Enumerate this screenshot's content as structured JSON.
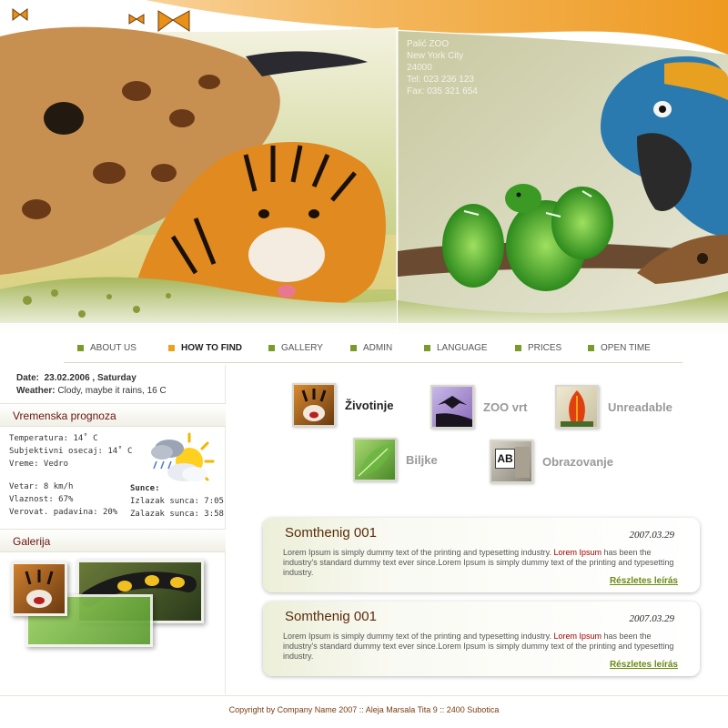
{
  "header": {
    "contact": {
      "name": "Palić ZOO",
      "city": "New York City",
      "zip": "24000",
      "tel": "Tel: 023 236 123",
      "fax": "Fax: 035 321 654"
    },
    "colors": {
      "orange": "#f0a030",
      "green": "#a8b850",
      "cream": "#f4e8c4"
    }
  },
  "nav": {
    "items": [
      {
        "label": "ABOUT US"
      },
      {
        "label": "HOW TO FIND",
        "active": true
      },
      {
        "label": "GALLERY"
      },
      {
        "label": "ADMIN"
      },
      {
        "label": "LANGUAGE"
      },
      {
        "label": "PRICES"
      },
      {
        "label": "OPEN TIME"
      }
    ]
  },
  "sidebar": {
    "date_label": "Date:",
    "date_value": "23.02.2006 ,  Saturday",
    "weather_label": "Weather:",
    "weather_value": "Clody, maybe it rains, 16 C",
    "forecast_heading": "Vremenska prognoza",
    "forecast": {
      "temperature": "Temperatura: 14˚ C",
      "subjective": "Subjektivni osecaj: 14˚ C",
      "conditions": "Vreme: Vedro",
      "wind": "Vetar: 8 km/h",
      "humidity": "Vlaznost: 67%",
      "precipitation": "Verovat. padavina: 20%",
      "sun_heading": "Sunce:",
      "sunrise": "Izlazak sunca: 7:05",
      "sunset": "Zalazak sunca: 3:58"
    },
    "gallery_heading": "Galerija"
  },
  "categories": [
    {
      "label": "Životinje",
      "dark": true
    },
    {
      "label": "ZOO vrt"
    },
    {
      "label": "Unreadable"
    },
    {
      "label": "Biljke"
    },
    {
      "label": "Obrazovanje"
    }
  ],
  "book_icon_text": "AB",
  "news": [
    {
      "title": "Somthenig 001",
      "date": "2007.03.29",
      "text_before": "Lorem Ipsum is simply dummy text of the printing and typesetting industry. ",
      "highlight": "Lorem Ipsum",
      "text_after": " has been the industry's standard dummy text ever since.Lorem Ipsum is simply dummy text of the printing and typesetting industry.",
      "more": "Részletes leírás"
    },
    {
      "title": "Somthenig 001",
      "date": "2007.03.29",
      "text_before": "Lorem Ipsum is simply dummy text of the printing and typesetting industry. ",
      "highlight": "Lorem Ipsum",
      "text_after": " has been the industry's standard dummy text ever since.Lorem Ipsum is simply dummy text of the printing and typesetting industry.",
      "more": "Részletes leírás"
    }
  ],
  "footer": {
    "text": "Copyright by Company Name 2007 ::  Aleja Marsala Tita 9 :: 2400 Subotica"
  }
}
